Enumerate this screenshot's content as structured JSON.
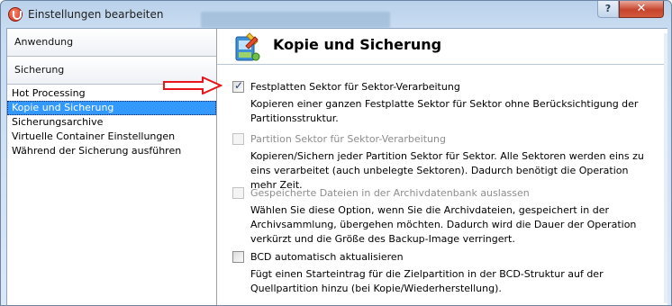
{
  "window": {
    "title": "Einstellungen bearbeiten",
    "help_label": "?",
    "close_label": "✕"
  },
  "nav": {
    "groups": [
      {
        "label": "Anwendung"
      },
      {
        "label": "Sicherung"
      }
    ],
    "items": [
      {
        "label": "Hot Processing"
      },
      {
        "label": "Kopie und Sicherung"
      },
      {
        "label": "Sicherungsarchive"
      },
      {
        "label": "Virtuelle Container Einstellungen"
      },
      {
        "label": "Während der Sicherung ausführen"
      }
    ],
    "selected_index": 1
  },
  "page": {
    "title": "Kopie und Sicherung",
    "icon": "backup-tools-icon"
  },
  "options": [
    {
      "label": "Festplatten Sektor für Sektor-Verarbeitung",
      "checked": true,
      "enabled": true,
      "description": "Kopieren einer ganzen Festplatte Sektor für Sektor ohne Berücksichtigung der Partitionsstruktur."
    },
    {
      "label": "Partition Sektor für Sektor-Verarbeitung",
      "checked": false,
      "enabled": false,
      "description": "Kopieren/Sichern jeder Partition Sektor für Sektor. Alle Sektoren werden eins zu eins verarbeitet (auch unbelegte Sektoren). Dadurch benötigt die Operation mehr Zeit."
    },
    {
      "label": "Gespeicherte Dateien in der Archivdatenbank auslassen",
      "checked": false,
      "enabled": false,
      "description": "Wählen Sie diese Option, wenn Sie die Archivdateien, gespeichert in der Archivsammlung, übergehen möchten. Dadurch wird die Dauer der Operation verkürzt und die Größe des Backup-Image verringert."
    },
    {
      "label": "BCD automatisch aktualisieren",
      "checked": false,
      "enabled": true,
      "description": "Fügt einen Starteintrag für die Zielpartition in der BCD-Struktur auf der Quellpartition hinzu (bei Kopie/Wiederherstellung)."
    }
  ],
  "annotation": {
    "icon": "red-arrow-icon",
    "color": "#e8161b"
  },
  "colors": {
    "selection": "#3399ff",
    "title_bar": "#b9d1ea",
    "close_button": "#c6442c"
  }
}
